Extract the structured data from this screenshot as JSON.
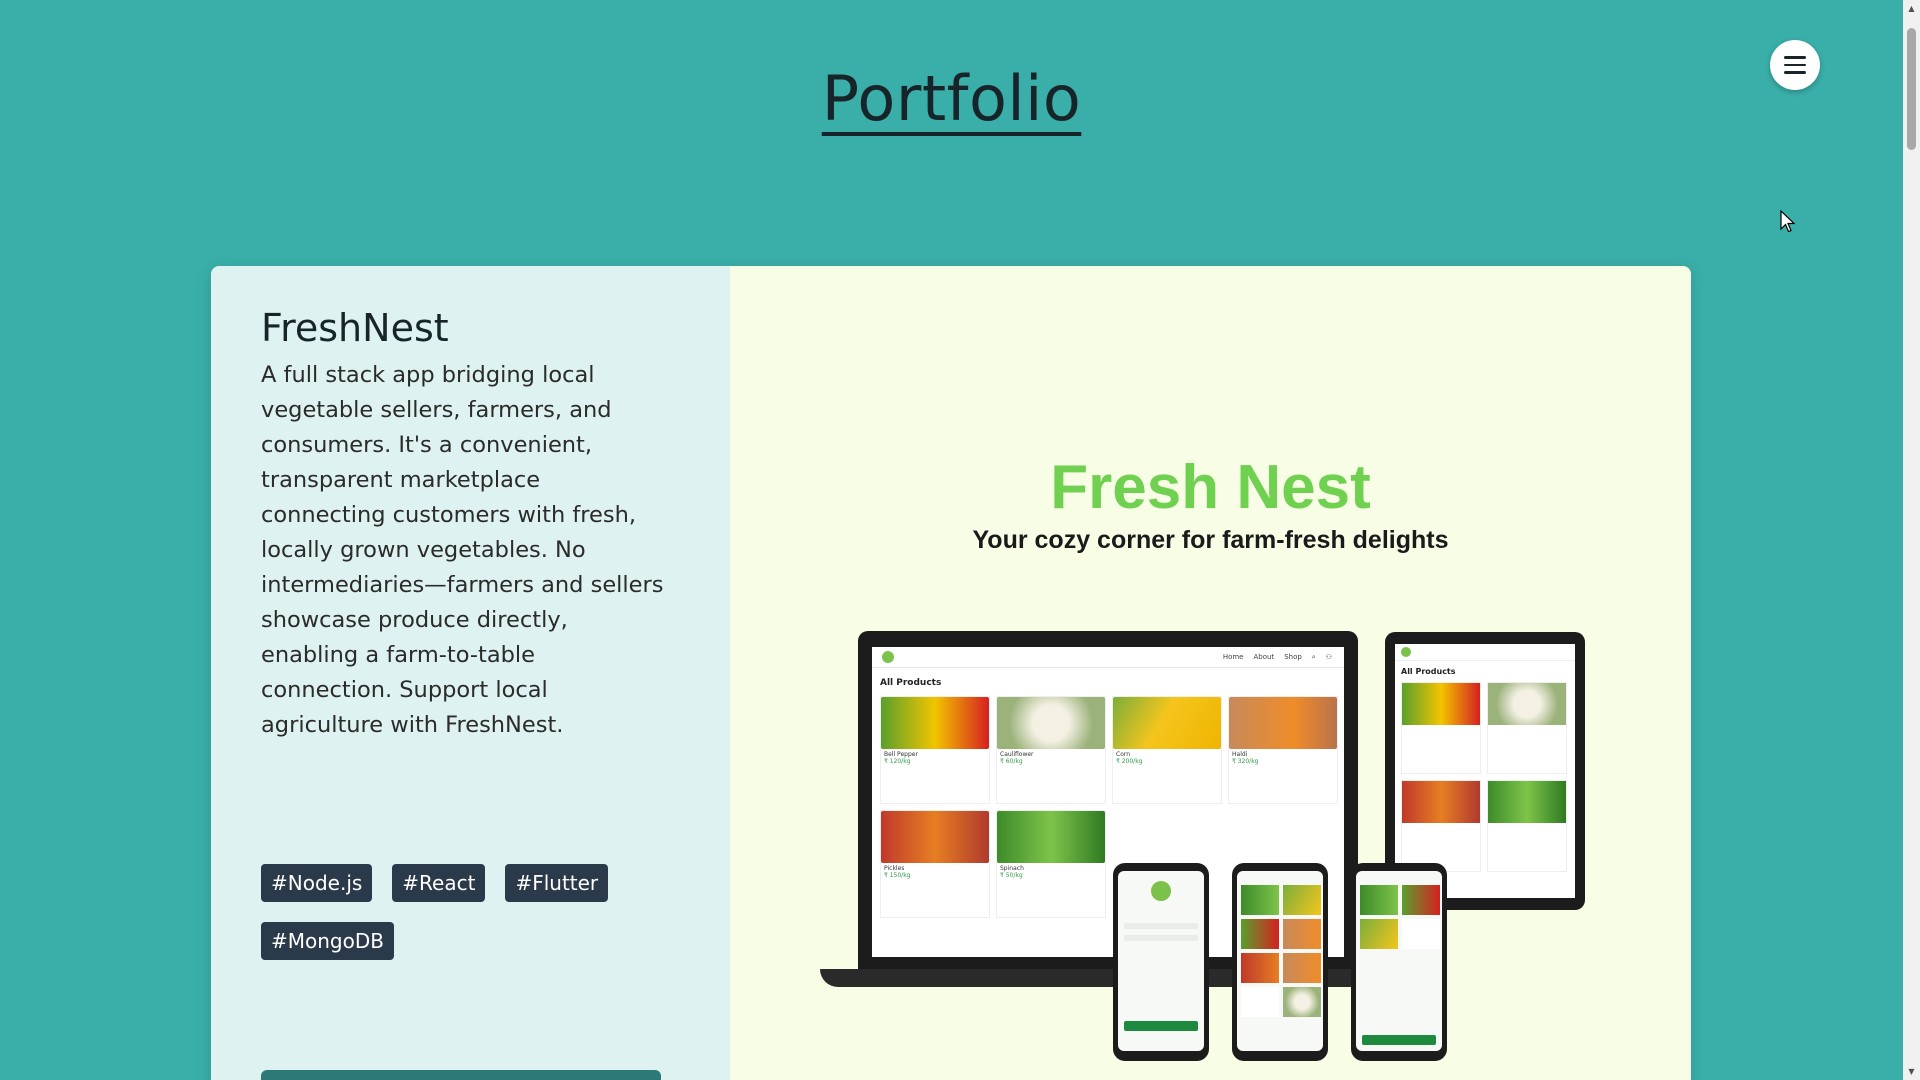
{
  "header": {
    "title": "Portfolio"
  },
  "menu": {
    "icon": "hamburger-menu-icon"
  },
  "project": {
    "title": "FreshNest",
    "description": "A full stack app bridging local vegetable sellers, farmers, and consumers. It's a convenient, transparent marketplace connecting customers with fresh, locally grown vegetables. No intermediaries—farmers and sellers showcase produce directly, enabling a farm-to-table connection. Support local agriculture with FreshNest.",
    "tags": [
      "#Node.js",
      "#React",
      "#Flutter",
      "#MongoDB"
    ]
  },
  "preview": {
    "brand": "Fresh Nest",
    "tagline": "Your cozy corner for farm-fresh delights",
    "laptop": {
      "nav": [
        "Home",
        "About",
        "Shop"
      ],
      "heading": "All Products",
      "products": [
        {
          "name": "Bell Pepper",
          "price": "₹ 120/kg"
        },
        {
          "name": "Cauliflower",
          "price": "₹ 60/kg"
        },
        {
          "name": "Corn",
          "price": "₹ 200/kg"
        },
        {
          "name": "Haldi",
          "price": "₹ 320/kg"
        },
        {
          "name": "Pickles",
          "price": "₹ 150/kg"
        },
        {
          "name": "Spinach",
          "price": "₹ 50/kg"
        }
      ]
    },
    "tablet": {
      "heading": "All Products"
    }
  },
  "colors": {
    "page_bg": "#3aafa9",
    "card_left_bg": "#def2f1",
    "card_right_bg": "#f8fde6",
    "tag_bg": "#2b3a4a",
    "brand_green": "#6fd14f",
    "title_color": "#17252a"
  }
}
